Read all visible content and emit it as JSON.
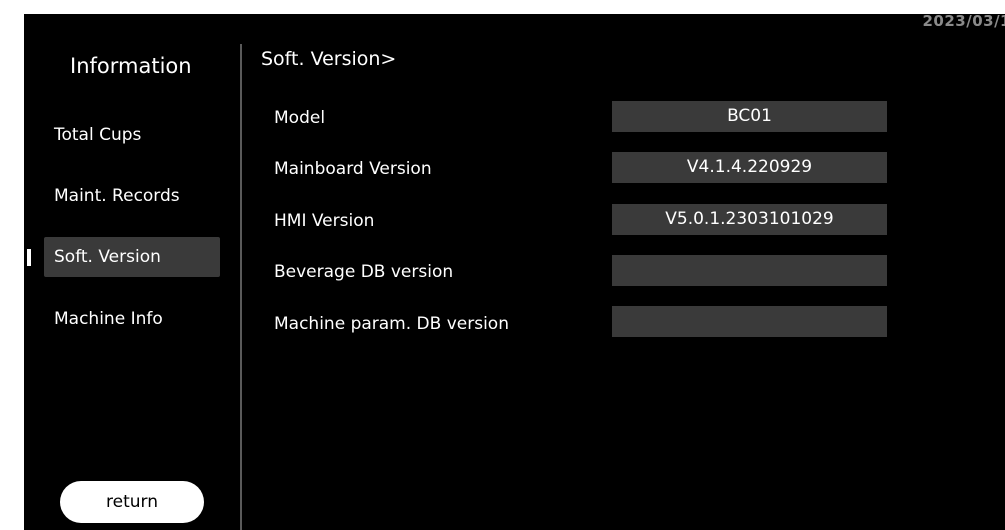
{
  "top_clipped_text": "",
  "clock": "2023/03/1",
  "sidebar": {
    "title": "Information",
    "items": [
      {
        "label": "Total Cups",
        "active": false
      },
      {
        "label": "Maint. Records",
        "active": false
      },
      {
        "label": "Soft. Version",
        "active": true
      },
      {
        "label": "Machine Info",
        "active": false
      }
    ],
    "return_label": "return"
  },
  "main": {
    "breadcrumb": "Soft. Version>",
    "rows": [
      {
        "label": "Model",
        "value": "BC01"
      },
      {
        "label": "Mainboard Version",
        "value": "V4.1.4.220929"
      },
      {
        "label": "HMI Version",
        "value": "V5.0.1.2303101029"
      },
      {
        "label": "Beverage DB version",
        "value": ""
      },
      {
        "label": "Machine param. DB version",
        "value": ""
      }
    ]
  },
  "colors": {
    "background": "#000000",
    "active_item": "#3a3a3a",
    "value_box": "#3a3a3a",
    "text": "#ffffff",
    "divider": "#5a5a5a"
  }
}
